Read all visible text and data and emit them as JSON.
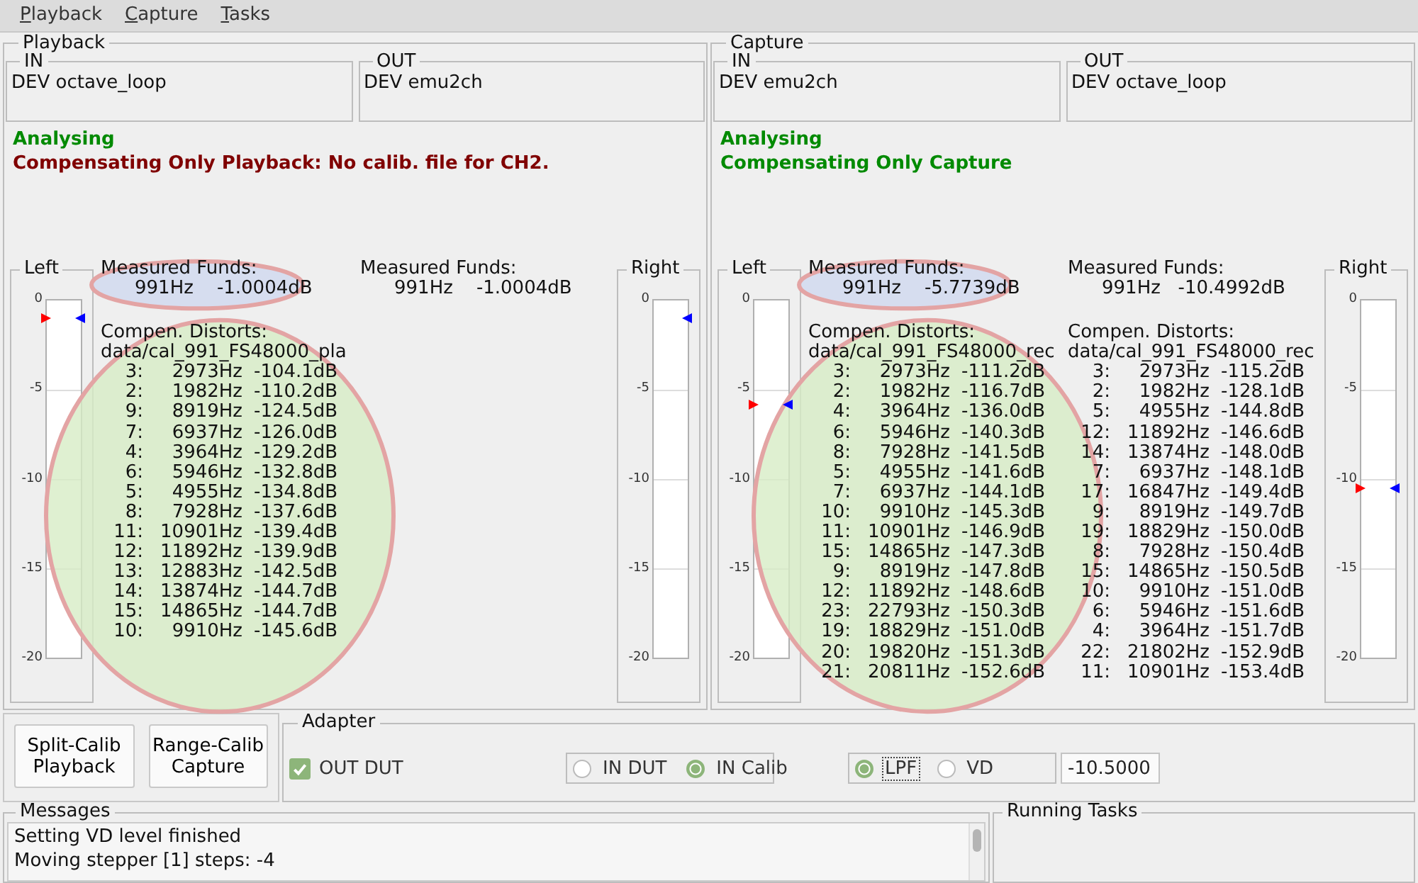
{
  "menu": [
    {
      "label": "Playback"
    },
    {
      "label": "Capture"
    },
    {
      "label": "Tasks"
    }
  ],
  "panels": [
    {
      "title": "Playback",
      "in": {
        "title": "IN",
        "value": "DEV octave_loop"
      },
      "out": {
        "title": "OUT",
        "value": "DEV emu2ch"
      },
      "status": [
        {
          "text": "Analysing",
          "error": false
        },
        {
          "text": "Compensating Only Playback:  No calib. file for CH2.",
          "error": true
        }
      ],
      "left_meter": {
        "title": "Left",
        "scale": [
          "0",
          "-5",
          "-10",
          "-15",
          "-20"
        ],
        "markers": [
          {
            "right_edge": false,
            "color": "#ff0000",
            "level": 0.95
          },
          {
            "right_edge": true,
            "color": "#0000ff",
            "level": 0.95
          }
        ]
      },
      "right_meter": {
        "title": "Right",
        "scale": [
          "0",
          "-5",
          "-10",
          "-15",
          "-20"
        ],
        "markers": [
          {
            "right_edge": true,
            "color": "#0000ff",
            "level": 0.95
          }
        ]
      },
      "columns": [
        {
          "highlighted": true,
          "funds_label": "Measured Funds:",
          "funds_value": "991Hz    -1.0004dB",
          "distorts_label": "Compen. Distorts:",
          "file": "data/cal_991_FS48000_pla",
          "rows": [
            {
              "harmonic": "3:",
              "freq": "2973Hz",
              "level_db": "-104.1dB"
            },
            {
              "harmonic": "2:",
              "freq": "1982Hz",
              "level_db": "-110.2dB"
            },
            {
              "harmonic": "9:",
              "freq": "8919Hz",
              "level_db": "-124.5dB"
            },
            {
              "harmonic": "7:",
              "freq": "6937Hz",
              "level_db": "-126.0dB"
            },
            {
              "harmonic": "4:",
              "freq": "3964Hz",
              "level_db": "-129.2dB"
            },
            {
              "harmonic": "6:",
              "freq": "5946Hz",
              "level_db": "-132.8dB"
            },
            {
              "harmonic": "5:",
              "freq": "4955Hz",
              "level_db": "-134.8dB"
            },
            {
              "harmonic": "8:",
              "freq": "7928Hz",
              "level_db": "-137.6dB"
            },
            {
              "harmonic": "11:",
              "freq": "10901Hz",
              "level_db": "-139.4dB"
            },
            {
              "harmonic": "12:",
              "freq": "11892Hz",
              "level_db": "-139.9dB"
            },
            {
              "harmonic": "13:",
              "freq": "12883Hz",
              "level_db": "-142.5dB"
            },
            {
              "harmonic": "14:",
              "freq": "13874Hz",
              "level_db": "-144.7dB"
            },
            {
              "harmonic": "15:",
              "freq": "14865Hz",
              "level_db": "-144.7dB"
            },
            {
              "harmonic": "10:",
              "freq": "9910Hz",
              "level_db": "-145.6dB"
            }
          ]
        },
        {
          "highlighted": false,
          "funds_label": "Measured Funds:",
          "funds_value": "991Hz    -1.0004dB"
        }
      ]
    },
    {
      "title": "Capture",
      "in": {
        "title": "IN",
        "value": "DEV emu2ch"
      },
      "out": {
        "title": "OUT",
        "value": "DEV octave_loop"
      },
      "status": [
        {
          "text": "Analysing",
          "error": false
        },
        {
          "text": "Compensating Only Capture",
          "error": false
        }
      ],
      "left_meter": {
        "title": "Left",
        "scale": [
          "0",
          "-5",
          "-10",
          "-15",
          "-20"
        ],
        "markers": [
          {
            "right_edge": false,
            "color": "#ff0000",
            "level": 0.71
          },
          {
            "right_edge": true,
            "color": "#0000ff",
            "level": 0.71
          }
        ]
      },
      "right_meter": {
        "title": "Right",
        "scale": [
          "0",
          "-5",
          "-10",
          "-15",
          "-20"
        ],
        "markers": [
          {
            "right_edge": false,
            "color": "#ff0000",
            "level": 0.475
          },
          {
            "right_edge": true,
            "color": "#0000ff",
            "level": 0.475
          }
        ]
      },
      "columns": [
        {
          "highlighted": true,
          "funds_label": "Measured Funds:",
          "funds_value": "991Hz    -5.7739dB",
          "distorts_label": "Compen. Distorts:",
          "file": "data/cal_991_FS48000_rec",
          "rows": [
            {
              "harmonic": "3:",
              "freq": "2973Hz",
              "level_db": "-111.2dB"
            },
            {
              "harmonic": "2:",
              "freq": "1982Hz",
              "level_db": "-116.7dB"
            },
            {
              "harmonic": "4:",
              "freq": "3964Hz",
              "level_db": "-136.0dB"
            },
            {
              "harmonic": "6:",
              "freq": "5946Hz",
              "level_db": "-140.3dB"
            },
            {
              "harmonic": "8:",
              "freq": "7928Hz",
              "level_db": "-141.5dB"
            },
            {
              "harmonic": "5:",
              "freq": "4955Hz",
              "level_db": "-141.6dB"
            },
            {
              "harmonic": "7:",
              "freq": "6937Hz",
              "level_db": "-144.1dB"
            },
            {
              "harmonic": "10:",
              "freq": "9910Hz",
              "level_db": "-145.3dB"
            },
            {
              "harmonic": "11:",
              "freq": "10901Hz",
              "level_db": "-146.9dB"
            },
            {
              "harmonic": "15:",
              "freq": "14865Hz",
              "level_db": "-147.3dB"
            },
            {
              "harmonic": "9:",
              "freq": "8919Hz",
              "level_db": "-147.8dB"
            },
            {
              "harmonic": "12:",
              "freq": "11892Hz",
              "level_db": "-148.6dB"
            },
            {
              "harmonic": "23:",
              "freq": "22793Hz",
              "level_db": "-150.3dB"
            },
            {
              "harmonic": "19:",
              "freq": "18829Hz",
              "level_db": "-151.0dB"
            },
            {
              "harmonic": "20:",
              "freq": "19820Hz",
              "level_db": "-151.3dB"
            },
            {
              "harmonic": "21:",
              "freq": "20811Hz",
              "level_db": "-152.6dB"
            }
          ]
        },
        {
          "highlighted": false,
          "funds_label": "Measured Funds:",
          "funds_value": "991Hz   -10.4992dB",
          "distorts_label": "Compen. Distorts:",
          "file": "data/cal_991_FS48000_rec",
          "rows": [
            {
              "harmonic": "3:",
              "freq": "2973Hz",
              "level_db": "-115.2dB"
            },
            {
              "harmonic": "2:",
              "freq": "1982Hz",
              "level_db": "-128.1dB"
            },
            {
              "harmonic": "5:",
              "freq": "4955Hz",
              "level_db": "-144.8dB"
            },
            {
              "harmonic": "12:",
              "freq": "11892Hz",
              "level_db": "-146.6dB"
            },
            {
              "harmonic": "14:",
              "freq": "13874Hz",
              "level_db": "-148.0dB"
            },
            {
              "harmonic": "7:",
              "freq": "6937Hz",
              "level_db": "-148.1dB"
            },
            {
              "harmonic": "17:",
              "freq": "16847Hz",
              "level_db": "-149.4dB"
            },
            {
              "harmonic": "9:",
              "freq": "8919Hz",
              "level_db": "-149.7dB"
            },
            {
              "harmonic": "19:",
              "freq": "18829Hz",
              "level_db": "-150.0dB"
            },
            {
              "harmonic": "8:",
              "freq": "7928Hz",
              "level_db": "-150.4dB"
            },
            {
              "harmonic": "15:",
              "freq": "14865Hz",
              "level_db": "-150.5dB"
            },
            {
              "harmonic": "10:",
              "freq": "9910Hz",
              "level_db": "-151.0dB"
            },
            {
              "harmonic": "6:",
              "freq": "5946Hz",
              "level_db": "-151.6dB"
            },
            {
              "harmonic": "4:",
              "freq": "3964Hz",
              "level_db": "-151.7dB"
            },
            {
              "harmonic": "22:",
              "freq": "21802Hz",
              "level_db": "-152.9dB"
            },
            {
              "harmonic": "11:",
              "freq": "10901Hz",
              "level_db": "-153.4dB"
            }
          ]
        }
      ]
    }
  ],
  "buttons": [
    {
      "label": "Split-Calib\nPlayback"
    },
    {
      "label": "Range-Calib\nCapture"
    }
  ],
  "adapter": {
    "title": "Adapter",
    "checkbox": {
      "label": "OUT DUT",
      "checked": true
    },
    "radio_groups": [
      [
        {
          "label": "IN DUT",
          "selected": false,
          "focused": false
        },
        {
          "label": "IN Calib",
          "selected": true,
          "focused": false
        }
      ],
      [
        {
          "label": "LPF",
          "selected": true,
          "focused": true
        },
        {
          "label": "VD",
          "selected": false,
          "focused": false
        }
      ]
    ],
    "value_field": {
      "value": "-10.5000"
    }
  },
  "messages": {
    "title": "Messages",
    "lines": [
      "Setting VD level finished",
      "Moving stepper [1] steps: -4"
    ]
  },
  "running_tasks": {
    "title": "Running Tasks"
  }
}
